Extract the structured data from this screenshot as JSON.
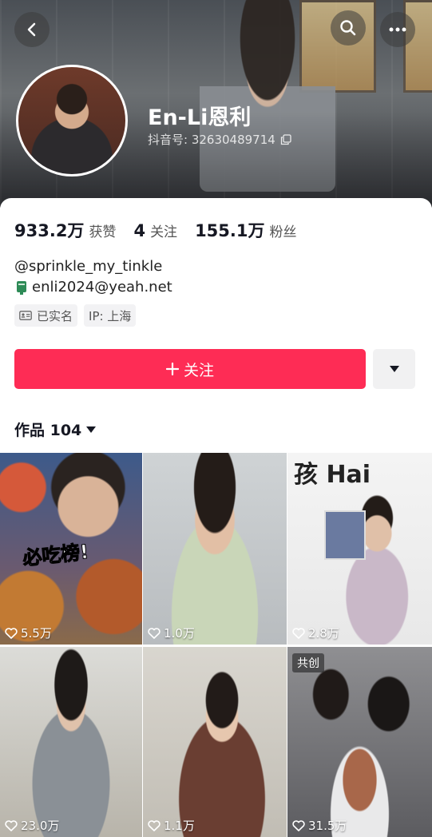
{
  "profile": {
    "name": "En-Li恩利",
    "douyin_id_label": "抖音号: 32630489714",
    "handle": "@sprinkle_my_tinkle",
    "email": "enli2024@yeah.net"
  },
  "stats": [
    {
      "num": "933.2万",
      "label": "获赞"
    },
    {
      "num": "4",
      "label": "关注"
    },
    {
      "num": "155.1万",
      "label": "粉丝"
    }
  ],
  "tags": {
    "verified": "已实名",
    "ip": "IP: 上海"
  },
  "actions": {
    "follow_label": "关注"
  },
  "works": {
    "label": "作品 104"
  },
  "videos": [
    {
      "likes": "5.5万",
      "overlay": "必吃榜!"
    },
    {
      "likes": "1.0万"
    },
    {
      "likes": "2.8万",
      "overlay": "孩 Hai"
    },
    {
      "likes": "23.0万"
    },
    {
      "likes": "1.1万"
    },
    {
      "likes": "31.5万",
      "badge": "共创"
    }
  ],
  "colors": {
    "accent": "#fe2c55",
    "text": "#161823"
  },
  "icons": [
    "back-icon",
    "search-icon",
    "more-icon",
    "copy-icon",
    "id-card-icon",
    "plus-icon",
    "caret-down-icon",
    "heart-icon"
  ]
}
